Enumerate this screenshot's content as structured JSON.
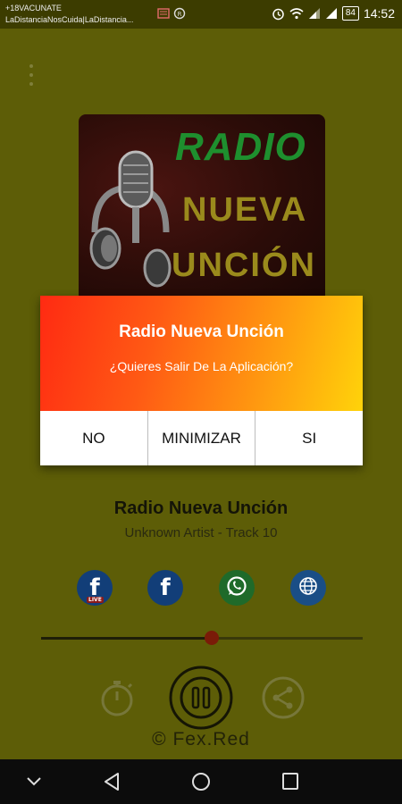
{
  "status_bar": {
    "notification_line1": "+18VACUNATE",
    "notification_line2": "LaDistanciaNosCuida|LaDistancia...",
    "battery": "84",
    "time": "14:52"
  },
  "album": {
    "logo_word1": "RADIO",
    "logo_word2": "NUEVA",
    "logo_word3": "UNCIÓN"
  },
  "dialog": {
    "title": "Radio Nueva Unción",
    "message": "¿Quieres Salir De La Aplicación?",
    "buttons": [
      "NO",
      "MINIMIZAR",
      "SI"
    ]
  },
  "track": {
    "title": "Radio Nueva Unción",
    "subtitle": "Unknown Artist  -  Track 10"
  },
  "social": {
    "live_label": "LIVE"
  },
  "player": {
    "progress": 0.53
  },
  "footer": {
    "credit": "© Fex.Red"
  },
  "colors": {
    "background": "#5d5d07",
    "dialog_gradient_start": "#ff2a12",
    "dialog_gradient_end": "#ffd30a",
    "thumb": "#7a1b08"
  }
}
